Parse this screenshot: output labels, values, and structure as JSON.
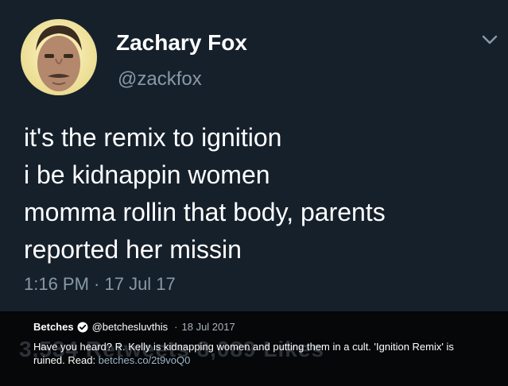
{
  "tweet": {
    "display_name": "Zachary Fox",
    "handle": "@zackfox",
    "lines": [
      "it's the remix to ignition",
      "i be kidnappin women",
      "momma rollin that body, parents",
      "reported her missin"
    ],
    "timestamp": "1:16 PM · 17 Jul 17"
  },
  "quote": {
    "name": "Betches",
    "handle": "@betchesluvthis",
    "separator": "·",
    "date": "18 Jul 2017",
    "text": "Have you heard? R. Kelly is kidnapping women and putting them in a cult. 'Ignition Remix' is ruined. Read: ",
    "link": "betches.co/2t9voQ0",
    "background_stats": "3,534 Retweets  8,089 Likes"
  },
  "colors": {
    "card_bg": "#15202b",
    "secondary_text": "#8899a6",
    "verified_badge": "#ffffff"
  },
  "icons": {
    "menu": "chevron-down-icon",
    "verified": "verified-badge-icon"
  }
}
